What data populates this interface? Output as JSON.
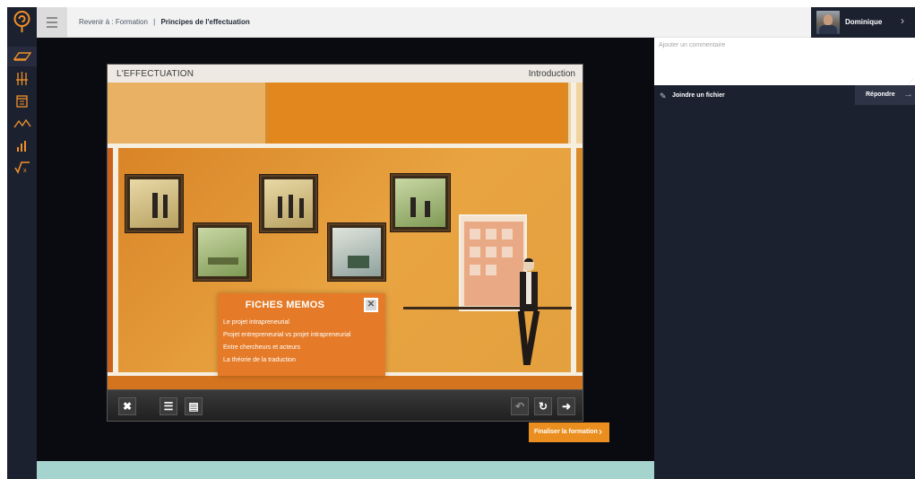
{
  "header": {
    "breadcrumb_back": "Revenir à : Formation",
    "breadcrumb_separator": "|",
    "breadcrumb_current": "Principes de l'effectuation"
  },
  "user": {
    "name": "Dominique",
    "chevron_icon": "chevron-right-icon"
  },
  "rail": {
    "logo_icon": "spiral-logo-icon",
    "items": [
      {
        "icon": "book-icon",
        "active": true
      },
      {
        "icon": "stacked-tools-icon"
      },
      {
        "icon": "calendar-icon"
      },
      {
        "icon": "trend-line-icon"
      },
      {
        "icon": "bar-chart-icon"
      },
      {
        "icon": "square-root-icon"
      }
    ]
  },
  "slide": {
    "title": "L'EFFECTUATION",
    "section": "Introduction",
    "memo": {
      "title": "FICHES MEMOS",
      "close_icon": "close-x-icon",
      "items": [
        "Le projet intrapreneurial",
        "Projet entrepreneurial vs projet intrapreneurial",
        "Entre chercheurs et acteurs",
        "La théorie de la traduction"
      ]
    },
    "controls": {
      "close": "✖",
      "list": "☰",
      "doc": "▤",
      "back": "↶",
      "replay": "↻",
      "next": "➜",
      "icons": [
        "close-icon",
        "list-icon",
        "document-icon",
        "back-arrow-icon",
        "replay-icon",
        "next-arrow-icon"
      ]
    }
  },
  "finalize": {
    "label": "Finaliser la formation",
    "arrow": "›"
  },
  "comments": {
    "placeholder": "Ajouter un commentaire",
    "attach_label": "Joindre un fichier",
    "attach_icon": "paperclip-icon",
    "reply_label": "Répondre",
    "reply_icon": "arrow-right-icon"
  },
  "colors": {
    "rail": "#1c2130",
    "accent_orange": "#ea8f1f",
    "memo_orange": "#e57b28",
    "teal_band": "#a5d3cd"
  }
}
